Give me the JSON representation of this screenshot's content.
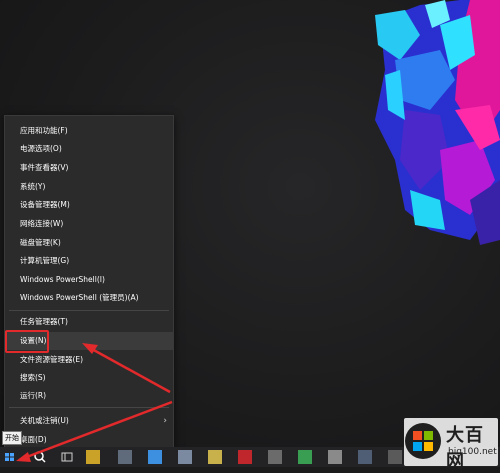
{
  "menu": {
    "items": [
      {
        "label": "应用和功能(F)"
      },
      {
        "label": "电源选项(O)"
      },
      {
        "label": "事件查看器(V)"
      },
      {
        "label": "系统(Y)"
      },
      {
        "label": "设备管理器(M)"
      },
      {
        "label": "网络连接(W)"
      },
      {
        "label": "磁盘管理(K)"
      },
      {
        "label": "计算机管理(G)"
      },
      {
        "label": "Windows PowerShell(I)"
      },
      {
        "label": "Windows PowerShell (管理员)(A)"
      },
      {
        "label": "任务管理器(T)"
      },
      {
        "label": "设置(N)"
      },
      {
        "label": "文件资源管理器(E)"
      },
      {
        "label": "搜索(S)"
      },
      {
        "label": "运行(R)"
      },
      {
        "label": "关机或注销(U)"
      },
      {
        "label": "桌面(D)"
      }
    ],
    "highlighted_item": "设置(N)"
  },
  "taskbar": {
    "start_tooltip": "开始"
  },
  "watermark": {
    "name": "大百网",
    "url": "big100.net"
  },
  "colors": {
    "annotation": "#e2292b",
    "menu_bg": "#2b2b2b",
    "desktop_bg": "#1b1b1c"
  }
}
